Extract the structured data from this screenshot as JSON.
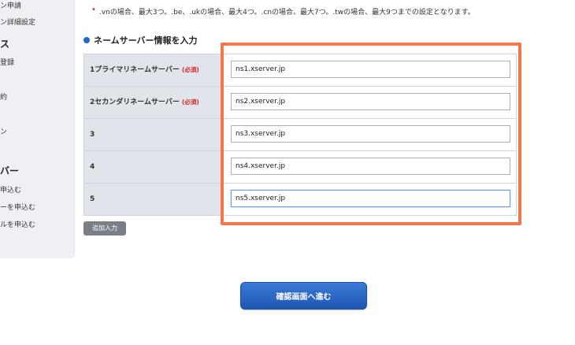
{
  "sidebar": {
    "items": [
      {
        "text": "ン申請",
        "type": "item"
      },
      {
        "text": "ン詳細設定",
        "type": "item"
      },
      {
        "text": "ス",
        "type": "heading"
      },
      {
        "text": "登録",
        "type": "item"
      },
      {
        "text": "約",
        "type": "item"
      },
      {
        "text": "ン",
        "type": "item"
      },
      {
        "text": "バー",
        "type": "heading"
      },
      {
        "text": "申込む",
        "type": "item"
      },
      {
        "text": "ーを申込む",
        "type": "item"
      },
      {
        "text": "ルを申込む",
        "type": "item"
      }
    ]
  },
  "note": {
    "bullet": "•",
    "text": ".vnの場合、最大3つ。.be、.ukの場合、最大4つ。.cnの場合、最大7つ。.twの場合、最大9つまでの設定となります。"
  },
  "section": {
    "title": "ネームサーバー情報を入力"
  },
  "nameservers": [
    {
      "label": "1プライマリネームサーバー",
      "required": "(必須)",
      "value": "ns1.xserver.jp"
    },
    {
      "label": "2セカンダリネームサーバー",
      "required": "(必須)",
      "value": "ns2.xserver.jp"
    },
    {
      "label": "3",
      "required": "",
      "value": "ns3.xserver.jp"
    },
    {
      "label": "4",
      "required": "",
      "value": "ns4.xserver.jp"
    },
    {
      "label": "5",
      "required": "",
      "value": "ns5.xserver.jp"
    }
  ],
  "buttons": {
    "add": "追加入力",
    "confirm": "確認画面へ進む"
  },
  "colors": {
    "highlight": "#f4774c",
    "accent": "#1f67c8",
    "required": "#d8262b"
  }
}
